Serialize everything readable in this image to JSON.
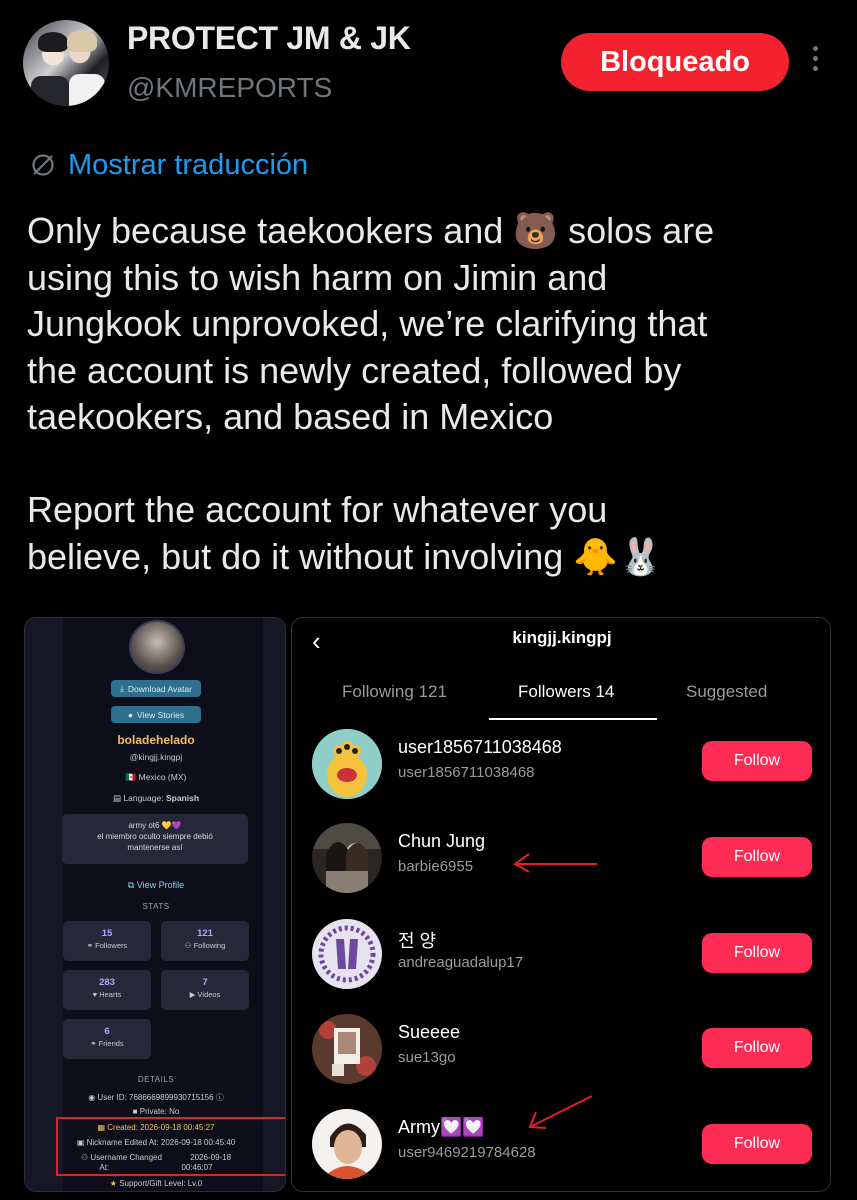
{
  "header": {
    "display_name": "PROTECT JM & JK",
    "handle": "@KMREPORTS",
    "blocked_label": "Bloqueado"
  },
  "translate": {
    "label": "Mostrar traducción"
  },
  "tweet": {
    "text": "Only because taekookers and 🐻 solos are\nusing this to wish harm on Jimin and\nJungkook unprovoked, we’re clarifying that\nthe account is newly created, followed by\ntaekookers, and based in Mexico\n\nReport the account for whatever you\nbelieve, but do it without involving 🐥🐰"
  },
  "left_card": {
    "download_avatar": "Download Avatar",
    "view_stories": "View Stories",
    "name": "boladehelado",
    "username": "@kingjj.kingpj",
    "location": "Mexico (MX)",
    "language_label": "Language:",
    "language": "Spanish",
    "bio": [
      "army ot6 💛💜",
      "el miembro oculto siempre debió",
      "mantenerse así"
    ],
    "view_profile": "View Profile",
    "stats_title": "STATS",
    "stats": [
      {
        "value": "15",
        "label": "Followers"
      },
      {
        "value": "121",
        "label": "Following"
      },
      {
        "value": "283",
        "label": "Hearts"
      },
      {
        "value": "7",
        "label": "Videos"
      },
      {
        "value": "6",
        "label": "Friends"
      }
    ],
    "details_title": "DETAILS",
    "user_id_label": "User ID:",
    "user_id": "7686669899930715156",
    "private_label": "Private:",
    "private": "No",
    "created_label": "Created:",
    "created": "2026-09-18 00:45:27",
    "nickname_label": "Nickname Edited At:",
    "nickname": "2026-09-18 00:45:40",
    "username_changed_label": "Username Changed",
    "username_changed_label2": "At:",
    "username_changed_date": "2026-09-18",
    "username_changed_time": "00:46:07",
    "support_label": "Support/Gift Level:",
    "support": "Lv.0"
  },
  "right_card": {
    "title": "kingjj.kingpj",
    "tabs": [
      "Following 121",
      "Followers 14",
      "Suggested"
    ],
    "active_tab": 1,
    "follow_label": "Follow",
    "users": [
      {
        "name": "user1856711038468",
        "username": "user1856711038468"
      },
      {
        "name": "Chun Jung",
        "username": "barbie6955"
      },
      {
        "name": "전 양",
        "username": "andreaguadalup17"
      },
      {
        "name": "Sueeee",
        "username": "sue13go"
      },
      {
        "name": "Army💟💟",
        "username": "user9469219784628"
      }
    ]
  },
  "colors": {
    "blocked": "#f4212e",
    "link": "#1d9bf0",
    "follow": "#fe2c55"
  }
}
